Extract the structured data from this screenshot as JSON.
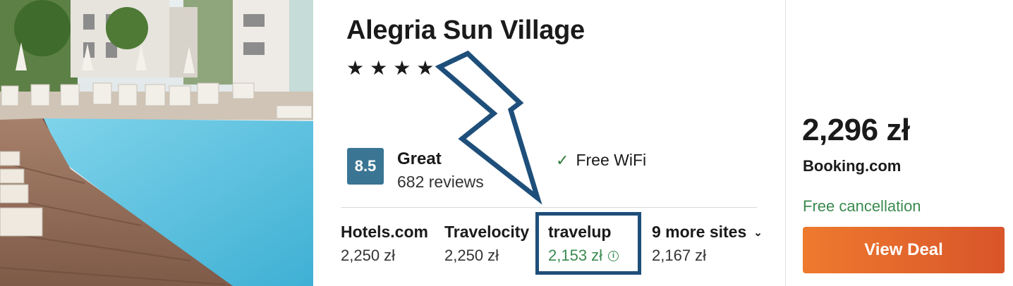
{
  "hotel": {
    "name": "Alegria Sun Village",
    "stars": "★★★★",
    "star_count": 4,
    "rating_score": "8.5",
    "rating_label": "Great",
    "reviews": "682 reviews",
    "amenity": "Free WiFi"
  },
  "sites": [
    {
      "name": "Hotels.com",
      "price": "2,250 zł"
    },
    {
      "name": "Travelocity",
      "price": "2,250 zł"
    },
    {
      "name": "travelup",
      "price": "2,153 zł"
    },
    {
      "name": "9 more sites",
      "price": "2,167 zł"
    }
  ],
  "deal": {
    "price": "2,296 zł",
    "provider": "Booking.com",
    "cancellation": "Free cancellation",
    "button_label": "View Deal"
  },
  "colors": {
    "score_bg": "#3a7593",
    "green": "#3a8a4f",
    "annotation": "#1e4f7a",
    "button": "#e56a2c"
  },
  "icons": {
    "amenity": "check-icon",
    "price_info": "info-icon",
    "more_sites": "chevron-down-icon"
  }
}
